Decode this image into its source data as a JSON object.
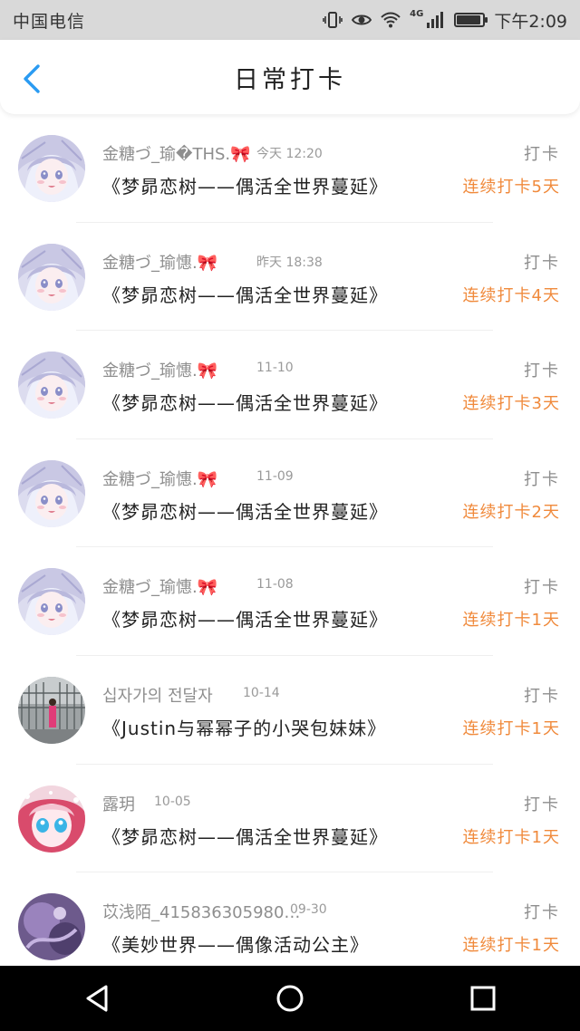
{
  "status_bar": {
    "carrier": "中国电信",
    "network": "4G",
    "time": "下午2:09",
    "battery_level": 0.9
  },
  "header": {
    "title": "日常打卡",
    "back_icon": "chevron-left-icon"
  },
  "accent_color": "#f08a3c",
  "checkins": [
    {
      "user": "金糖づ_瑜�THS.",
      "badge": "🎀",
      "time": "今天 12:20",
      "action": "打卡",
      "book": "《梦昴恋树——偶活全世界蔓延》",
      "streak": "连续打卡5天",
      "avatar": "anime-girl"
    },
    {
      "user": "金糖づ_瑜憓.",
      "badge": "🎀",
      "time": "昨天 18:38",
      "action": "打卡",
      "book": "《梦昴恋树——偶活全世界蔓延》",
      "streak": "连续打卡4天",
      "avatar": "anime-girl"
    },
    {
      "user": "金糖づ_瑜憓.",
      "badge": "🎀",
      "time": "11-10",
      "action": "打卡",
      "book": "《梦昴恋树——偶活全世界蔓延》",
      "streak": "连续打卡3天",
      "avatar": "anime-girl"
    },
    {
      "user": "金糖づ_瑜憓.",
      "badge": "🎀",
      "time": "11-09",
      "action": "打卡",
      "book": "《梦昴恋树——偶活全世界蔓延》",
      "streak": "连续打卡2天",
      "avatar": "anime-girl"
    },
    {
      "user": "金糖づ_瑜憓.",
      "badge": "🎀",
      "time": "11-08",
      "action": "打卡",
      "book": "《梦昴恋树——偶活全世界蔓延》",
      "streak": "连续打卡1天",
      "avatar": "anime-girl"
    },
    {
      "user": "십자가의 전달자",
      "badge": "",
      "time": "10-14",
      "action": "打卡",
      "book": "《Justin与幂幂子的小哭包妹妹》",
      "streak": "连续打卡1天",
      "avatar": "street-photo"
    },
    {
      "user": "露玥",
      "badge": "",
      "time": "10-05",
      "action": "打卡",
      "book": "《梦昴恋树——偶活全世界蔓延》",
      "streak": "连续打卡1天",
      "avatar": "anime-blue"
    },
    {
      "user": "苡浅陌_415836305980…",
      "badge": "",
      "time": "09-30",
      "action": "打卡",
      "book": "《美妙世界——偶像活动公主》",
      "streak": "连续打卡1天",
      "avatar": "purple-art"
    }
  ],
  "nav_bar": {
    "back_icon": "triangle-back-icon",
    "home_icon": "circle-home-icon",
    "recents_icon": "square-recents-icon"
  }
}
